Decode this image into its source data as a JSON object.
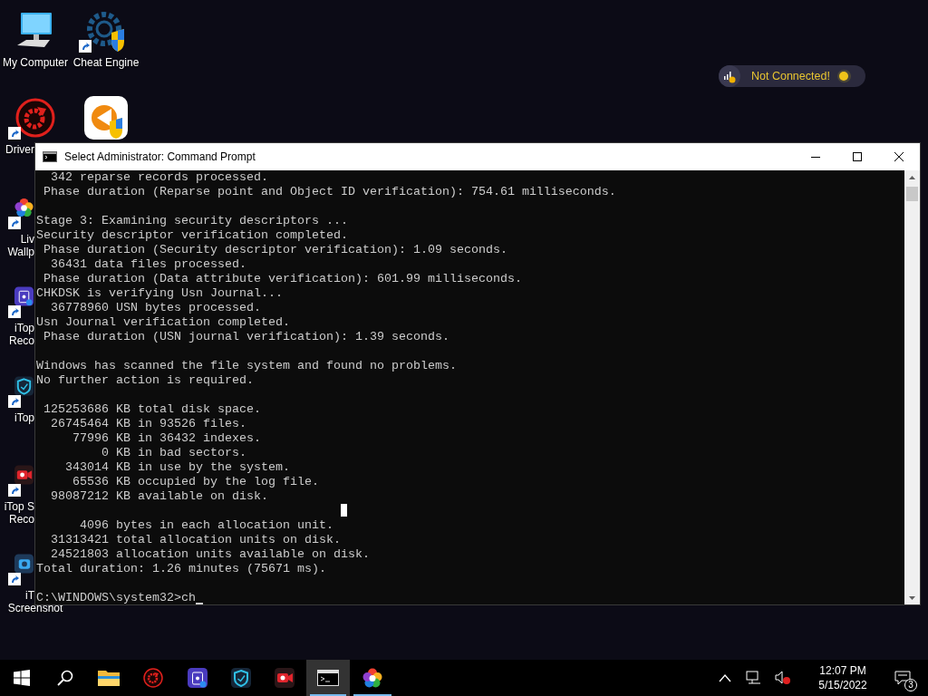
{
  "desktop_icons": [
    {
      "kind": "computer",
      "shortcut": false,
      "lines": [
        {
          "text": "My Computer",
          "clipped": false
        }
      ]
    },
    {
      "kind": "gear",
      "shortcut": true,
      "lines": [
        {
          "text": "Cheat Engine",
          "clipped": false
        }
      ]
    },
    {
      "kind": "booster",
      "shortcut": true,
      "lines": [
        {
          "text": "Driver",
          "clipped": true
        }
      ]
    },
    {
      "kind": "shield",
      "shortcut": false
    },
    {
      "kind": "petals",
      "shortcut": true,
      "lines": [
        {
          "text": "Liv",
          "clipped": true
        },
        {
          "text": "Wallp",
          "clipped": true
        }
      ]
    },
    {
      "kind": "recorder",
      "shortcut": true,
      "lines": [
        {
          "text": "iTop",
          "clipped": true
        },
        {
          "text": "Reco",
          "clipped": true
        }
      ]
    },
    {
      "kind": "vpn",
      "shortcut": true,
      "lines": [
        {
          "text": "iTop",
          "clipped": true
        }
      ]
    },
    {
      "kind": "camera",
      "shortcut": true,
      "lines": [
        {
          "text": "iTop S",
          "clipped": true
        },
        {
          "text": "Reco",
          "clipped": true
        }
      ]
    },
    {
      "kind": "snap",
      "shortcut": true,
      "lines": [
        {
          "text": "iT",
          "clipped": true
        },
        {
          "text": "Screenshot",
          "clipped": false
        }
      ]
    }
  ],
  "vpn_widget": {
    "status": "Not Connected!",
    "on": false
  },
  "window": {
    "title": "Select Administrator: Command Prompt",
    "console_blocks": [
      [
        "  342 reparse records processed.",
        " Phase duration (Reparse point and Object ID verification): 754.61 milliseconds."
      ],
      [
        "Stage 3: Examining security descriptors ...",
        "Security descriptor verification completed.",
        " Phase duration (Security descriptor verification): 1.09 seconds.",
        "  36431 data files processed.",
        " Phase duration (Data attribute verification): 601.99 milliseconds.",
        "CHKDSK is verifying Usn Journal...",
        "  36778960 USN bytes processed.",
        "Usn Journal verification completed.",
        " Phase duration (USN journal verification): 1.39 seconds."
      ],
      [
        "Windows has scanned the file system and found no problems.",
        "No further action is required."
      ],
      [
        " 125253686 KB total disk space.",
        "  26745464 KB in 93526 files.",
        "     77996 KB in 36432 indexes.",
        "         0 KB in bad sectors.",
        "    343014 KB in use by the system.",
        "     65536 KB occupied by the log file.",
        "  98087212 KB available on disk."
      ],
      [
        "      4096 bytes in each allocation unit.",
        "  31313421 total allocation units on disk.",
        "  24521803 allocation units available on disk.",
        "Total duration: 1.26 minutes (75671 ms)."
      ]
    ],
    "prompt": "C:\\WINDOWS\\system32>",
    "input": "ch"
  },
  "taskbar": {
    "apps": [
      {
        "kind": "start",
        "running": false,
        "selected": false
      },
      {
        "kind": "search",
        "running": false,
        "selected": false
      },
      {
        "kind": "folder",
        "running": false,
        "selected": false
      },
      {
        "kind": "booster",
        "running": false,
        "selected": false
      },
      {
        "kind": "recorder",
        "running": false,
        "selected": false
      },
      {
        "kind": "vpn",
        "running": false,
        "selected": false
      },
      {
        "kind": "camera",
        "running": false,
        "selected": false
      },
      {
        "kind": "console",
        "running": true,
        "selected": true
      },
      {
        "kind": "petals",
        "running": true,
        "selected": false
      }
    ],
    "time": "12:07 PM",
    "date": "5/15/2022",
    "notifications": "3"
  }
}
